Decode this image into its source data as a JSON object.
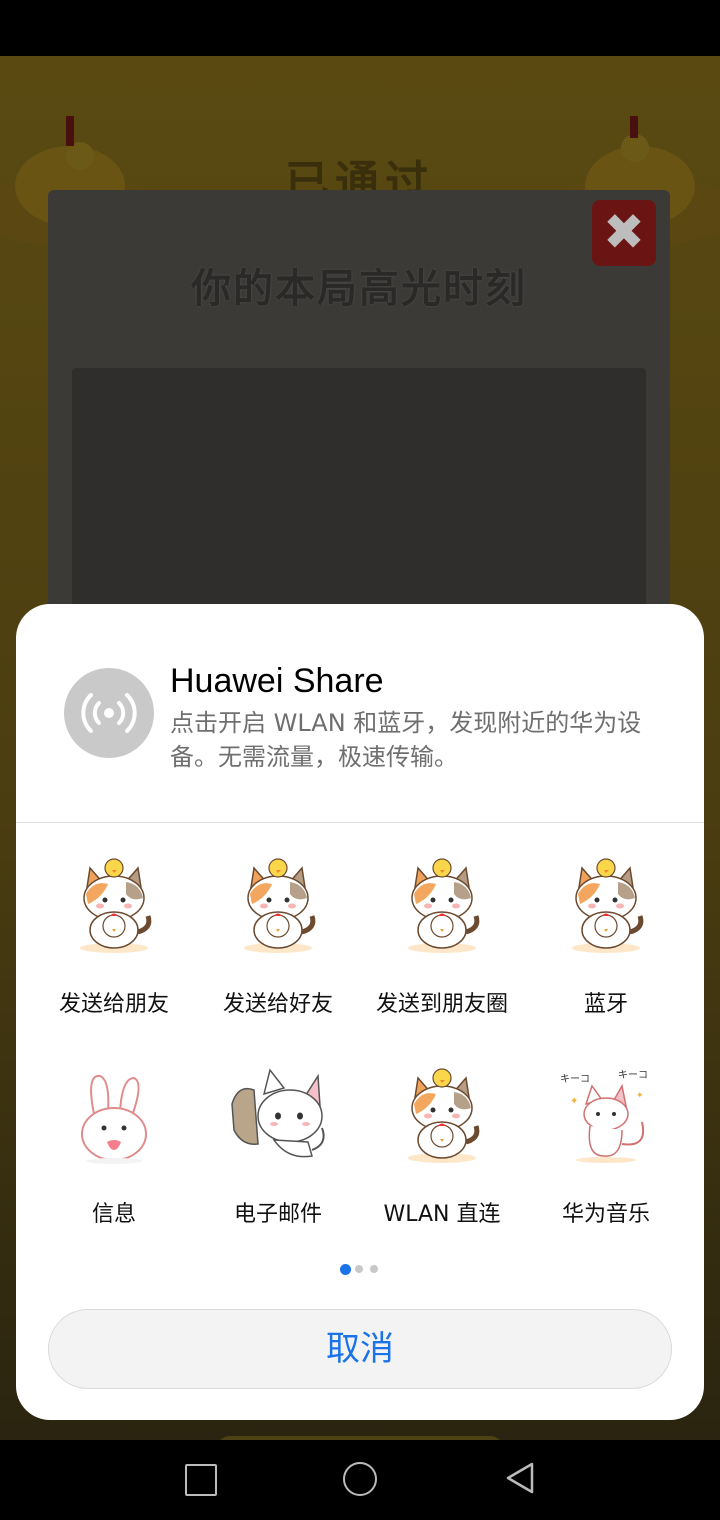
{
  "background": {
    "passed_title": "已通过",
    "highlight_title": "你的本局高光时刻",
    "close_symbol": "✖"
  },
  "share_sheet": {
    "huawei_share": {
      "title": "Huawei Share",
      "description": "点击开启 WLAN 和蓝牙，发现附近的华为设备。无需流量，极速传输。",
      "icon": "wireless-broadcast-icon"
    },
    "apps": [
      {
        "label": "发送给朋友",
        "icon": "cat-chick-sticker-icon"
      },
      {
        "label": "发送给好友",
        "icon": "cat-chick-sticker-icon"
      },
      {
        "label": "发送到朋友圈",
        "icon": "cat-chick-sticker-icon"
      },
      {
        "label": "蓝牙",
        "icon": "cat-chick-sticker-icon"
      },
      {
        "label": "信息",
        "icon": "bunny-sticker-icon"
      },
      {
        "label": "电子邮件",
        "icon": "white-cat-sticker-icon"
      },
      {
        "label": "WLAN 直连",
        "icon": "cat-chick-sticker-icon"
      },
      {
        "label": "华为音乐",
        "icon": "kitten-sticker-icon"
      }
    ],
    "page_indicator": {
      "pages": 3,
      "current": 1
    },
    "cancel_label": "取消",
    "accent_color": "#1a73e8"
  },
  "navigation": {
    "icons": [
      "recent-apps-icon",
      "home-icon",
      "back-icon"
    ]
  }
}
